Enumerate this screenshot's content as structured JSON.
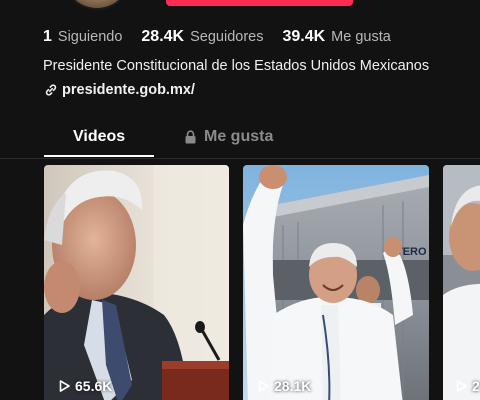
{
  "profile": {
    "stats": [
      {
        "value": "1",
        "label": "Siguiendo"
      },
      {
        "value": "28.4K",
        "label": "Seguidores"
      },
      {
        "value": "39.4K",
        "label": "Me gusta"
      }
    ],
    "bio": "Presidente Constitucional de los Estados Unidos Mexicanos",
    "link": "presidente.gob.mx/",
    "link_icon": "link-icon"
  },
  "tabs": {
    "videos_label": "Videos",
    "likes_label": "Me gusta",
    "likes_icon": "lock-icon"
  },
  "videos": [
    {
      "views": "65.6K"
    },
    {
      "views": "28.1K"
    },
    {
      "views": "2"
    }
  ],
  "colors": {
    "background": "#121212",
    "accent": "#fe2c55",
    "muted_text": "#8a8a8a"
  }
}
